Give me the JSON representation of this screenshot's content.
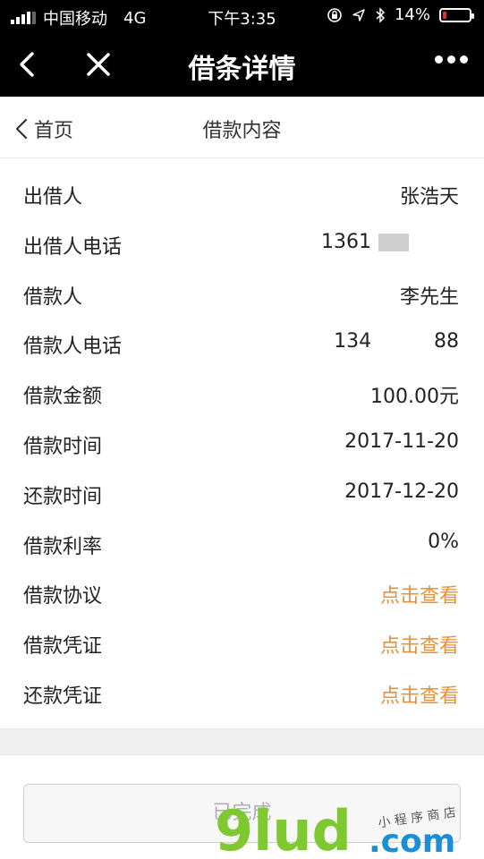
{
  "status_bar": {
    "carrier": "中国移动",
    "network": "4G",
    "time": "下午3:35",
    "battery_text": "14%",
    "battery_level": 0.14,
    "icons": [
      "signal-icon",
      "lock-rotation-icon",
      "location-icon",
      "bluetooth-icon",
      "battery-icon"
    ]
  },
  "nav_bar": {
    "title": "借条详情",
    "icons": [
      "back-arrow-icon",
      "close-icon",
      "more-icon"
    ]
  },
  "sub_header": {
    "back_label": "首页",
    "title": "借款内容"
  },
  "details": [
    {
      "label": "出借人",
      "value": "张浩天"
    },
    {
      "label": "出借人电话",
      "value": "1361"
    },
    {
      "label": "借款人",
      "value": "李先生"
    },
    {
      "label": "借款人电话",
      "value": "134          88"
    },
    {
      "label": "借款金额",
      "value": "100.00元"
    },
    {
      "label": "借款时间",
      "value": "2017-11-20"
    },
    {
      "label": "还款时间",
      "value": "2017-12-20"
    },
    {
      "label": "借款利率",
      "value": "0%"
    },
    {
      "label": "借款协议",
      "value": "点击查看"
    },
    {
      "label": "借款凭证",
      "value": "点击查看"
    },
    {
      "label": "还款凭证",
      "value": "点击查看"
    }
  ],
  "status_button": {
    "label": "已完成"
  },
  "watermark": {
    "logo": "9lud.com",
    "tagline": "小程序商店"
  },
  "colors": {
    "link": "#e8913b",
    "watermark_green": "#7ec832",
    "watermark_blue": "#1a8fd6"
  }
}
